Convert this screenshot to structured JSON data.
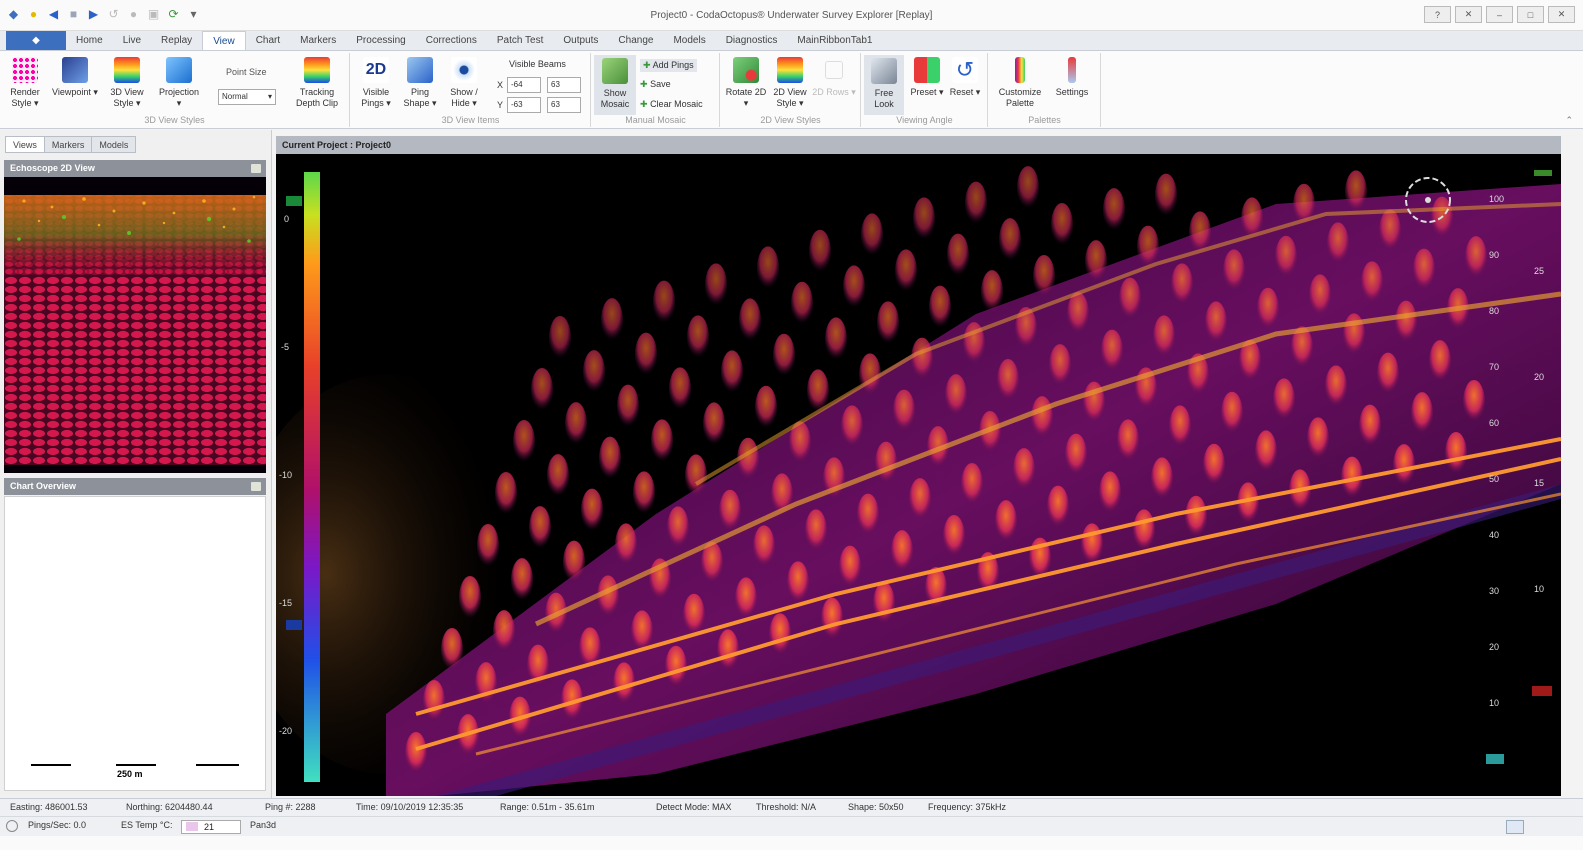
{
  "window": {
    "title": "Project0 - CodaOctopus® Underwater Survey Explorer [Replay]",
    "buttons": [
      "?",
      "✕",
      "–",
      "□",
      "✕"
    ]
  },
  "quick_access": [
    "app-icon",
    "new-icon",
    "back-icon",
    "stop-icon",
    "play-icon",
    "undo-icon",
    "record-icon",
    "snapshot-icon",
    "refresh-icon",
    "dropdown-icon"
  ],
  "tabs": [
    "Home",
    "Live",
    "Replay",
    "View",
    "Chart",
    "Markers",
    "Processing",
    "Corrections",
    "Patch Test",
    "Outputs",
    "Change",
    "Models",
    "Diagnostics",
    "MainRibbonTab1"
  ],
  "active_tab": "View",
  "ribbon": {
    "view_styles": {
      "label": "3D View Styles",
      "render_style": "Render Style",
      "viewpoint": "Viewpoint",
      "view_style_3d": "3D View Style",
      "projection": "Projection",
      "point_size_label": "Point Size",
      "point_size_value": "Normal",
      "tracking_depth_clip": "Tracking Depth Clip"
    },
    "view_items": {
      "label": "3D View Items",
      "visible_pings": "Visible Pings",
      "ping_shape": "Ping Shape",
      "show_hide": "Show / Hide",
      "visible_beams": "Visible Beams",
      "x_label": "X",
      "y_label": "Y",
      "x_min": "-64",
      "x_max": "63",
      "y_min": "-63",
      "y_max": "63"
    },
    "manual_mosaic": {
      "label": "Manual Mosaic",
      "show_mosaic": "Show Mosaic",
      "add_pings": "Add Pings",
      "save": "Save",
      "clear_mosaic": "Clear Mosaic"
    },
    "view_styles_2d": {
      "label": "2D View Styles",
      "rotate_2d": "Rotate 2D",
      "view_style_2d": "2D View Style",
      "rows_2d": "2D Rows"
    },
    "viewing_angle": {
      "label": "Viewing Angle",
      "free_look": "Free Look",
      "preset": "Preset",
      "reset": "Reset"
    },
    "palettes": {
      "label": "Palettes",
      "customize_palette": "Customize Palette",
      "settings": "Settings"
    }
  },
  "left_panel": {
    "tabs": [
      "Views",
      "Markers",
      "Models"
    ],
    "echoscope_title": "Echoscope 2D View",
    "chart_overview_title": "Chart Overview",
    "scale_label": "250 m"
  },
  "viewport": {
    "header": "Current Project : Project0",
    "depth_scale_ticks": [
      "0",
      "-5",
      "-10",
      "-15",
      "-20"
    ],
    "range_ticks_inner": [
      "100",
      "90",
      "80",
      "70",
      "60",
      "50",
      "40",
      "30",
      "20",
      "10"
    ],
    "range_ticks_outer": [
      "25",
      "20",
      "15",
      "10"
    ]
  },
  "status": {
    "easting": "Easting:  486001.53",
    "northing": "Northing:  6204480.44",
    "ping": "Ping #:  2288",
    "time": "Time:  09/10/2019 12:35:35",
    "range": "Range:  0.51m - 35.61m",
    "detect_mode": "Detect Mode:  MAX",
    "threshold": "Threshold:  N/A",
    "shape": "Shape:  50x50",
    "frequency": "Frequency:  375kHz",
    "pings_sec": "Pings/Sec:   0.0",
    "es_temp_label": "ES Temp °C:",
    "es_temp_value": "21",
    "pan": "Pan3d"
  },
  "colors": {
    "palette": [
      "#ff8c1a",
      "#e83a3a",
      "#8a1ac4",
      "#1a4be8",
      "#33e0d0",
      "#8cf03a"
    ],
    "accent": "#3d6fbf"
  }
}
